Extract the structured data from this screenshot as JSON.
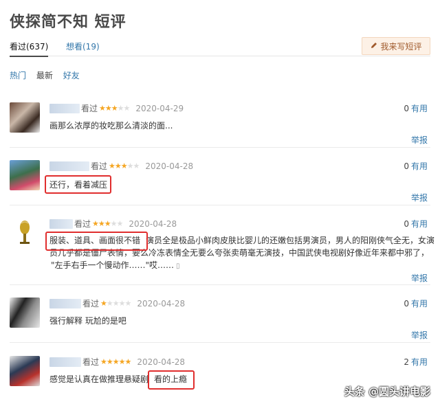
{
  "page": {
    "title": "侠探简不知 短评"
  },
  "tabs": {
    "watched": "看过(637)",
    "want": "想看(19)"
  },
  "write_button": {
    "label": "我来写短评"
  },
  "sorts": [
    "热门",
    "最新",
    "好友"
  ],
  "reviews": [
    {
      "status": "看过",
      "rating": 3,
      "date": "2020-04-29",
      "useful_count": "0",
      "useful_label": "有用",
      "text": "画那么浓厚的妆吃那么清淡的面...",
      "report": "举报"
    },
    {
      "status": "看过",
      "rating": 3,
      "date": "2020-04-28",
      "useful_count": "0",
      "useful_label": "有用",
      "text": "还行，看着减压",
      "report": "举报"
    },
    {
      "status": "看过",
      "rating": 3,
      "date": "2020-04-28",
      "useful_count": "0",
      "useful_label": "有用",
      "text_highlight": "服装、道具、画面很不错",
      "text_line1": "演员全是极品小鲜肉皮肤比婴儿的还嫩包括男演员，男人的阳刚侠气全无，女演",
      "text_line2": "员几乎都是僵尸表情，要么冷冻表情全无要么夸张卖萌毫无演技，中国武侠电视剧好像近年来都中邪了，",
      "text_line3": "\"左手右手一个慢动作……\"哎……",
      "report": "举报"
    },
    {
      "status": "看过",
      "rating": 1,
      "date": "2020-04-28",
      "useful_count": "0",
      "useful_label": "有用",
      "text": "强行解释 玩尬的是吧",
      "report": "举报"
    },
    {
      "status": "看过",
      "rating": 5,
      "date": "2020-04-28",
      "useful_count": "2",
      "useful_label": "有用",
      "text": "感觉是认真在做推理悬疑剧",
      "text_highlight": "看的上瘾"
    }
  ],
  "watermark": "头条 @圆头讲电影",
  "colors": {
    "link": "#3377aa",
    "star": "#f5a623",
    "highlight_box": "#e02d2d"
  }
}
